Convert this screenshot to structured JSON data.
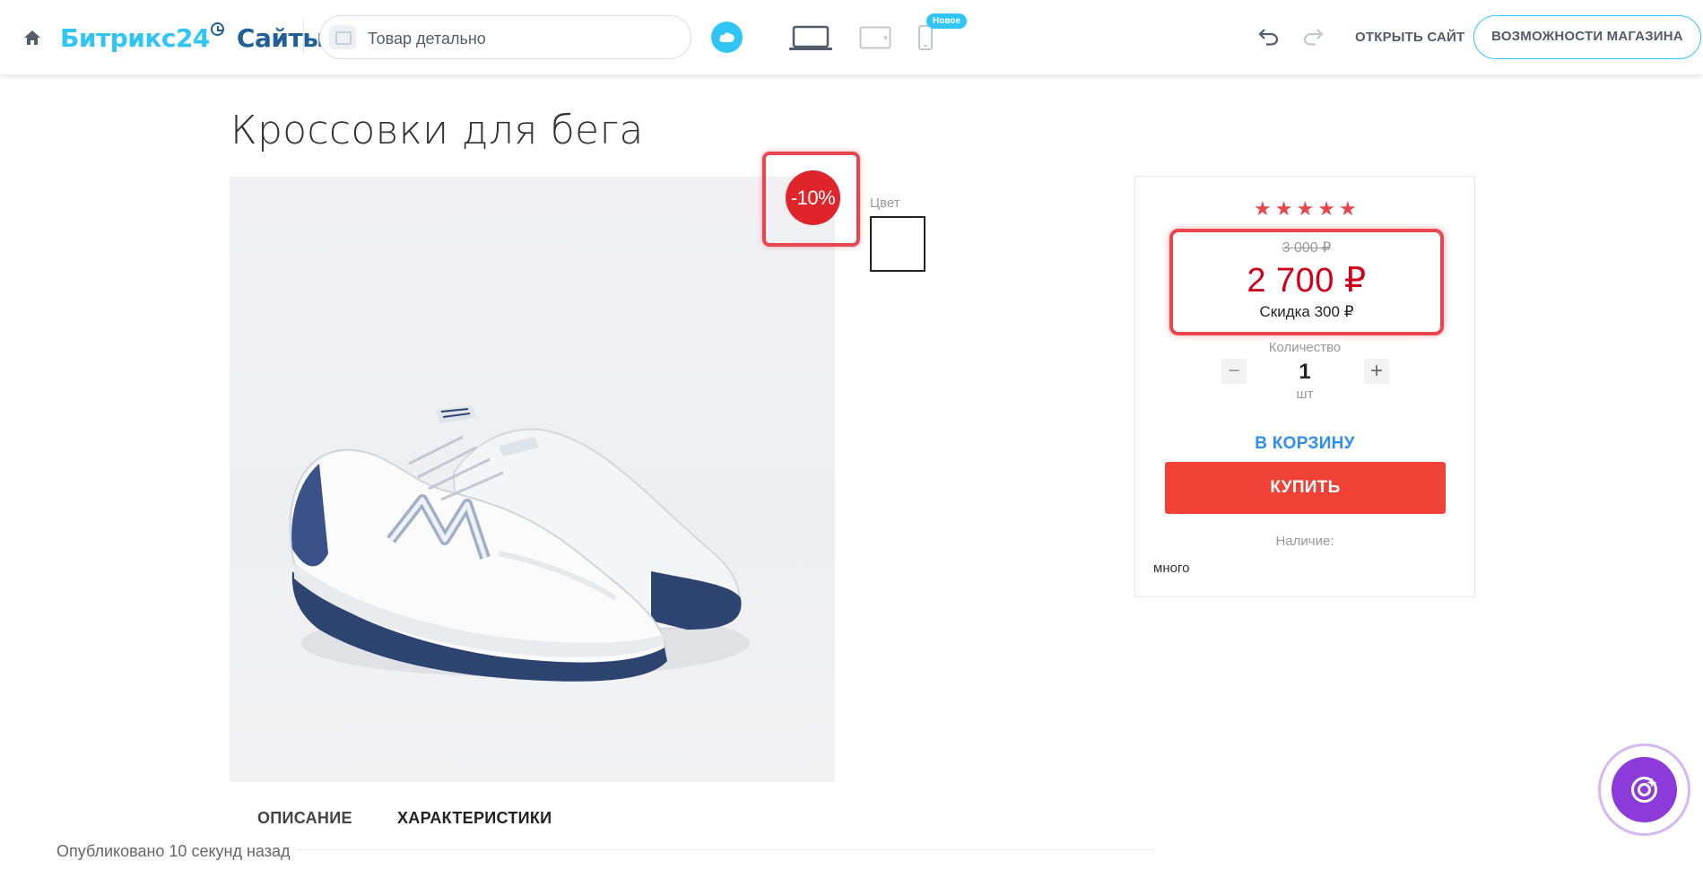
{
  "toolbar": {
    "logo_brand": "Битрикс24",
    "logo_product": "Сайты",
    "page_select_label": "Товар детально",
    "new_badge": "Новое",
    "open_site_label": "ОТКРЫТЬ САЙТ",
    "store_features_label": "ВОЗМОЖНОСТИ МАГАЗИНА",
    "icons": [
      "home-icon",
      "cloud-icon",
      "desktop-icon",
      "tablet-icon",
      "mobile-icon",
      "undo-icon",
      "redo-icon"
    ]
  },
  "product": {
    "title": "Кроссовки для бега",
    "discount_badge": "-10%",
    "color_label": "Цвет",
    "rating_stars": 5,
    "old_price": "3 000 ₽",
    "price": "2 700 ₽",
    "saving": "Скидка 300 ₽",
    "quantity_label": "Количество",
    "quantity_value": "1",
    "quantity_unit": "шт",
    "to_cart_label": "В КОРЗИНУ",
    "buy_label": "КУПИТЬ",
    "availability_label": "Наличие:",
    "availability_value": "много"
  },
  "tabs": [
    "ОПИСАНИЕ",
    "ХАРАКТЕРИСТИКИ"
  ],
  "status": {
    "published": "Опубликовано 10 секунд назад"
  },
  "colors": {
    "accent_blue": "#2fc6f6",
    "brand_dark_blue": "#215f98",
    "highlight_red": "#e8474f",
    "price_red": "#d0001b",
    "buy_button": "#ef4136",
    "link_blue": "#2f8ef4",
    "ai_purple": "#8c3ad9"
  }
}
